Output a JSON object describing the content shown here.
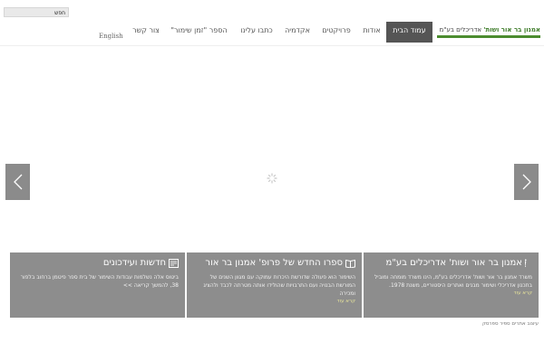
{
  "search": {
    "label": "חפש"
  },
  "logo": {
    "name": "אמנון בר אור ושות'",
    "rest": " אדריכלים בע\"מ"
  },
  "nav": {
    "items": [
      {
        "label": "עמוד הבית",
        "active": true
      },
      {
        "label": "אודות"
      },
      {
        "label": "פרויקטים"
      },
      {
        "label": "אקדמיה"
      },
      {
        "label": "כתבו עלינו"
      },
      {
        "label": "הספר \"זמן שימור\""
      },
      {
        "label": "צור קשר"
      }
    ],
    "language": "English"
  },
  "slider": {
    "prev_icon": "chevron-left-icon",
    "next_icon": "chevron-right-icon",
    "loading_icon": "spinner-icon"
  },
  "panels": [
    {
      "title": "אמנון בר אור ושות' אדריכלים בע\"מ",
      "icon": "info-icon",
      "text": "משרד אמנון בר אור ושות' אדריכלים בע\"מ, הינו משרד מומחה ומוביל בתכנון אדריכלי ושימור מבנים ואתרים היסטוריים, משנת 1978.",
      "more": "קרא עוד"
    },
    {
      "title": "ספרו החדש של פרופ' אמנון בר אור",
      "icon": "book-icon",
      "text": "השימור הוא פעולה שדורשת היכרות עמוקה עם מגוון השנים של המורשת הבנויה ועם התרבויות שהולידו אותה מטרתה לכבד ולהציג ומכירה",
      "more": "קרא עוד"
    },
    {
      "title": "חדשות ועידכונים",
      "icon": "news-icon",
      "text": "ביטוס אלה נשלמות עבודות השימור של בית ספר פיטמן ברחוב בלפור 38, להמשך קריאה >>",
      "more": ""
    }
  ],
  "footer": {
    "note": "עיצוב אתרים ספיר ספרסק"
  },
  "colors": {
    "accent": "#4b8c2f",
    "panel_bg": "#8d8d8d",
    "nav_active": "#555555"
  }
}
